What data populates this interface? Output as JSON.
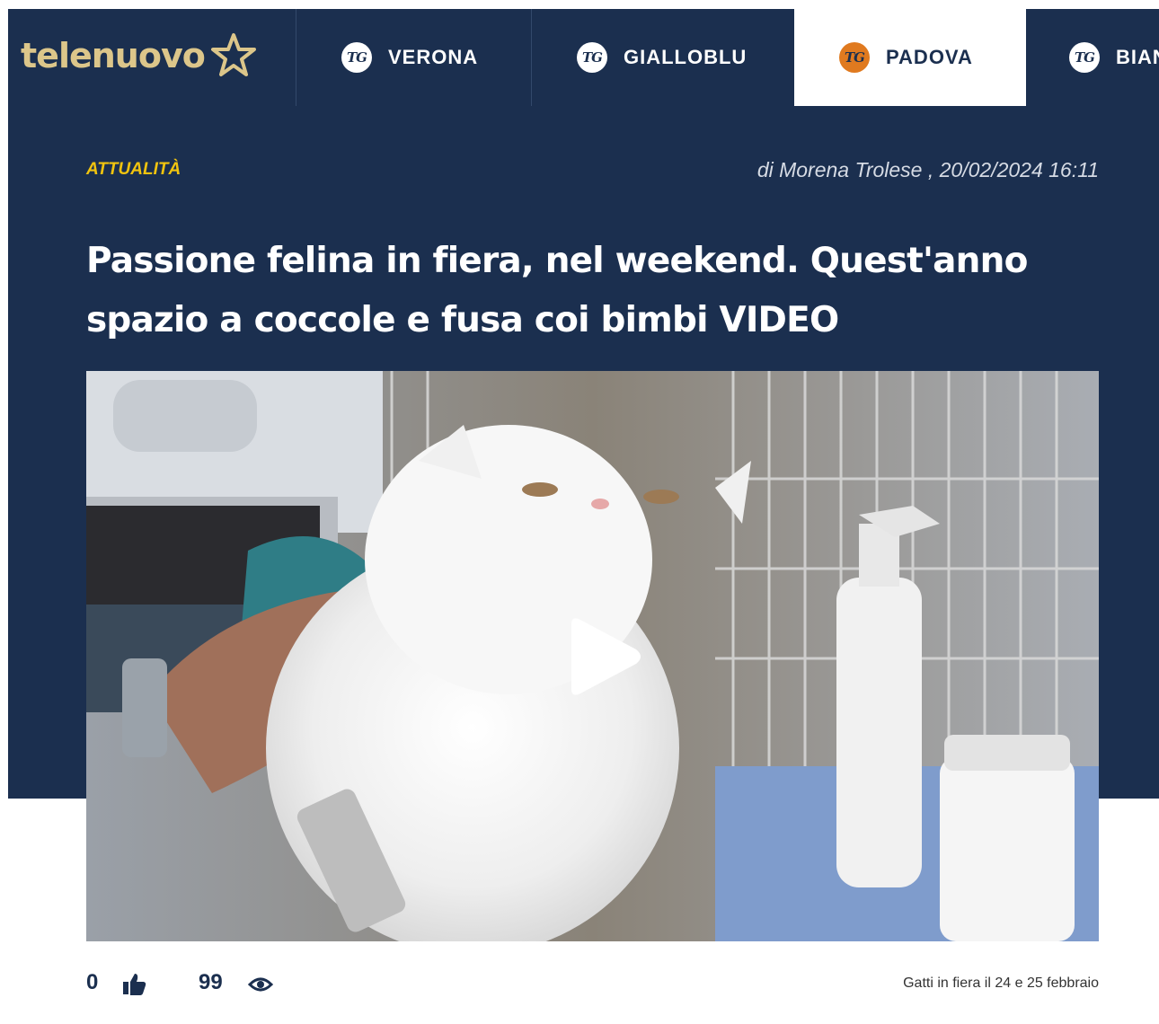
{
  "site": {
    "logo_text": "telenuovo"
  },
  "nav": {
    "items": [
      {
        "label": "VERONA",
        "badge": "TG"
      },
      {
        "label": "GIALLOBLU",
        "badge": "TG"
      },
      {
        "label": "PADOVA",
        "badge": "TG",
        "active": true
      },
      {
        "label": "BIAN",
        "badge": "TG"
      }
    ]
  },
  "article": {
    "category": "ATTUALITÀ",
    "byline": "di Morena Trolese , 20/02/2024 16:11",
    "headline": "Passione felina in fiera, nel weekend. Quest'anno spazio a coccole e fusa coi bimbi VIDEO",
    "caption": "Gatti in fiera il 24 e 25 febbraio"
  },
  "stats": {
    "likes": "0",
    "views": "99"
  },
  "colors": {
    "navy": "#1b2f4f",
    "gold": "#dcc68a",
    "category_yellow": "#f1c40f",
    "active_badge_orange": "#e07a1f"
  },
  "icons": [
    "star-icon",
    "tg-badge-icon",
    "play-icon",
    "thumbs-up-icon",
    "eye-icon"
  ]
}
